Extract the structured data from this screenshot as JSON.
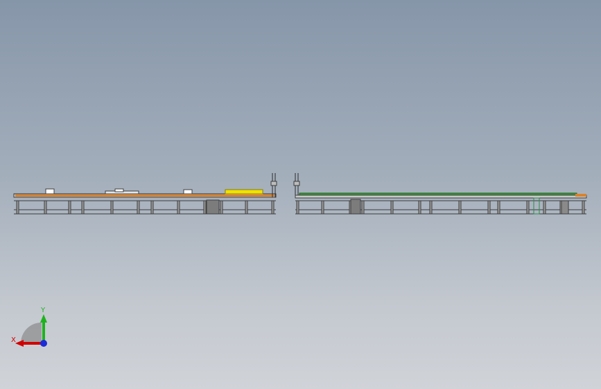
{
  "viewport": {
    "background_top": "#8696a9",
    "background_bottom": "#d0d3d8"
  },
  "model": {
    "frame_color": "#4a4a4a",
    "roller_color": "#d9822b",
    "belt_color": "#3a9a3a",
    "highlight_color": "#f2e200"
  },
  "triad": {
    "x_label": "X",
    "y_label": "Y",
    "x_color": "#d10000",
    "y_color": "#1fb21f",
    "z_color": "#1c2bd8"
  }
}
